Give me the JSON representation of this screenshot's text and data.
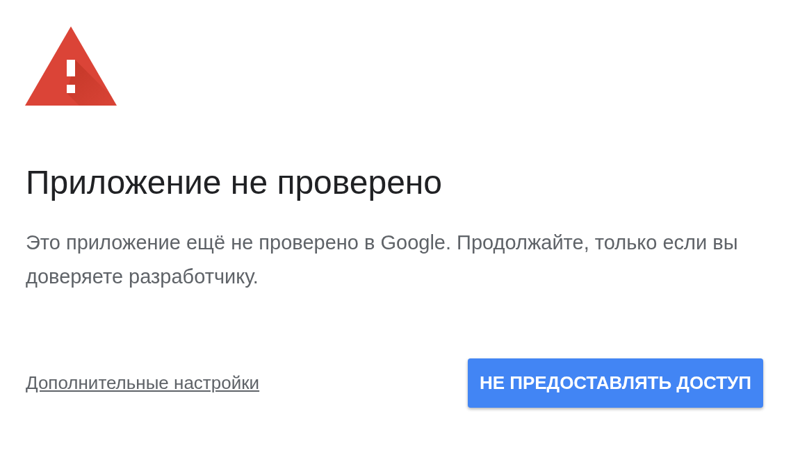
{
  "warning": {
    "title": "Приложение не проверено",
    "message": "Это приложение ещё не проверено в Google. Продолжайте, только если вы доверяете разработчику."
  },
  "footer": {
    "link": "Дополнительные настройки",
    "button": "НЕ ПРЕДОСТАВЛЯТЬ ДОСТУП"
  }
}
